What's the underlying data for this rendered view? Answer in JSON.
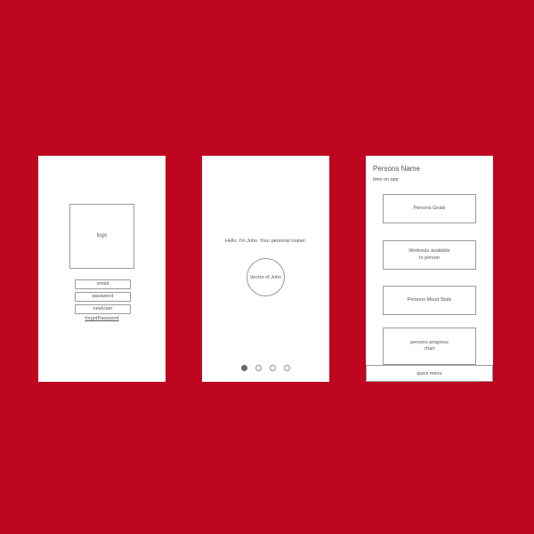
{
  "login_screen": {
    "logo_label": "logo",
    "email_label": "email",
    "password_label": "password",
    "new_user_label": "newUser",
    "forgot_password_label": "forgotPassword"
  },
  "intro_screen": {
    "greeting": "Hello, I'm John. Your personal trainer.",
    "avatar_label": "Vector of John",
    "pager": {
      "total": 4,
      "active_index": 0
    }
  },
  "profile_screen": {
    "name": "Persons Name",
    "time_on_app": "time on app",
    "cards": [
      "Persons Goals",
      "Workouts available\nto person",
      "Persons Mood Stats",
      "persons progress\nchart"
    ],
    "quick_menu_label": "quick menu"
  }
}
